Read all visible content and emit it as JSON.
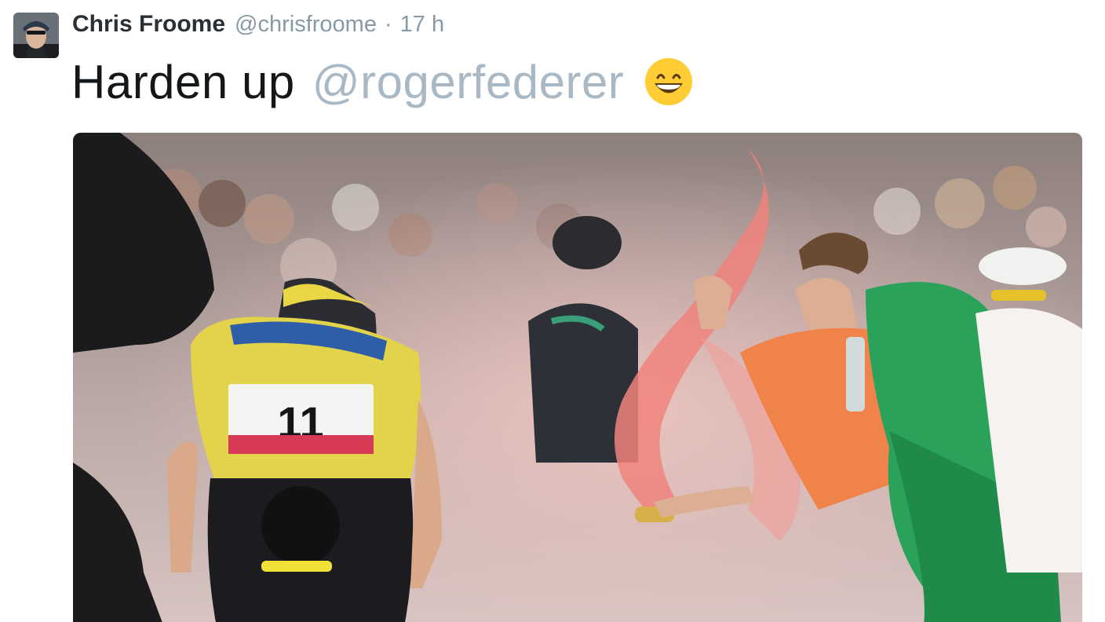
{
  "tweet": {
    "author": {
      "name": "Chris Froome",
      "handle": "@chrisfroome",
      "avatar_icon": "profile-photo"
    },
    "separator": "·",
    "timestamp": "17 h",
    "text": "Harden up",
    "mention": "@rogerfederer",
    "emoji_icon": "grinning-face-emoji",
    "media": {
      "type": "photo",
      "icon": "cycling-race-photo",
      "jersey_number": "11"
    }
  },
  "colors": {
    "mention": "#a8b8c4",
    "meta": "#8899a6",
    "text": "#14171a",
    "emoji_face": "#ffcc33"
  }
}
